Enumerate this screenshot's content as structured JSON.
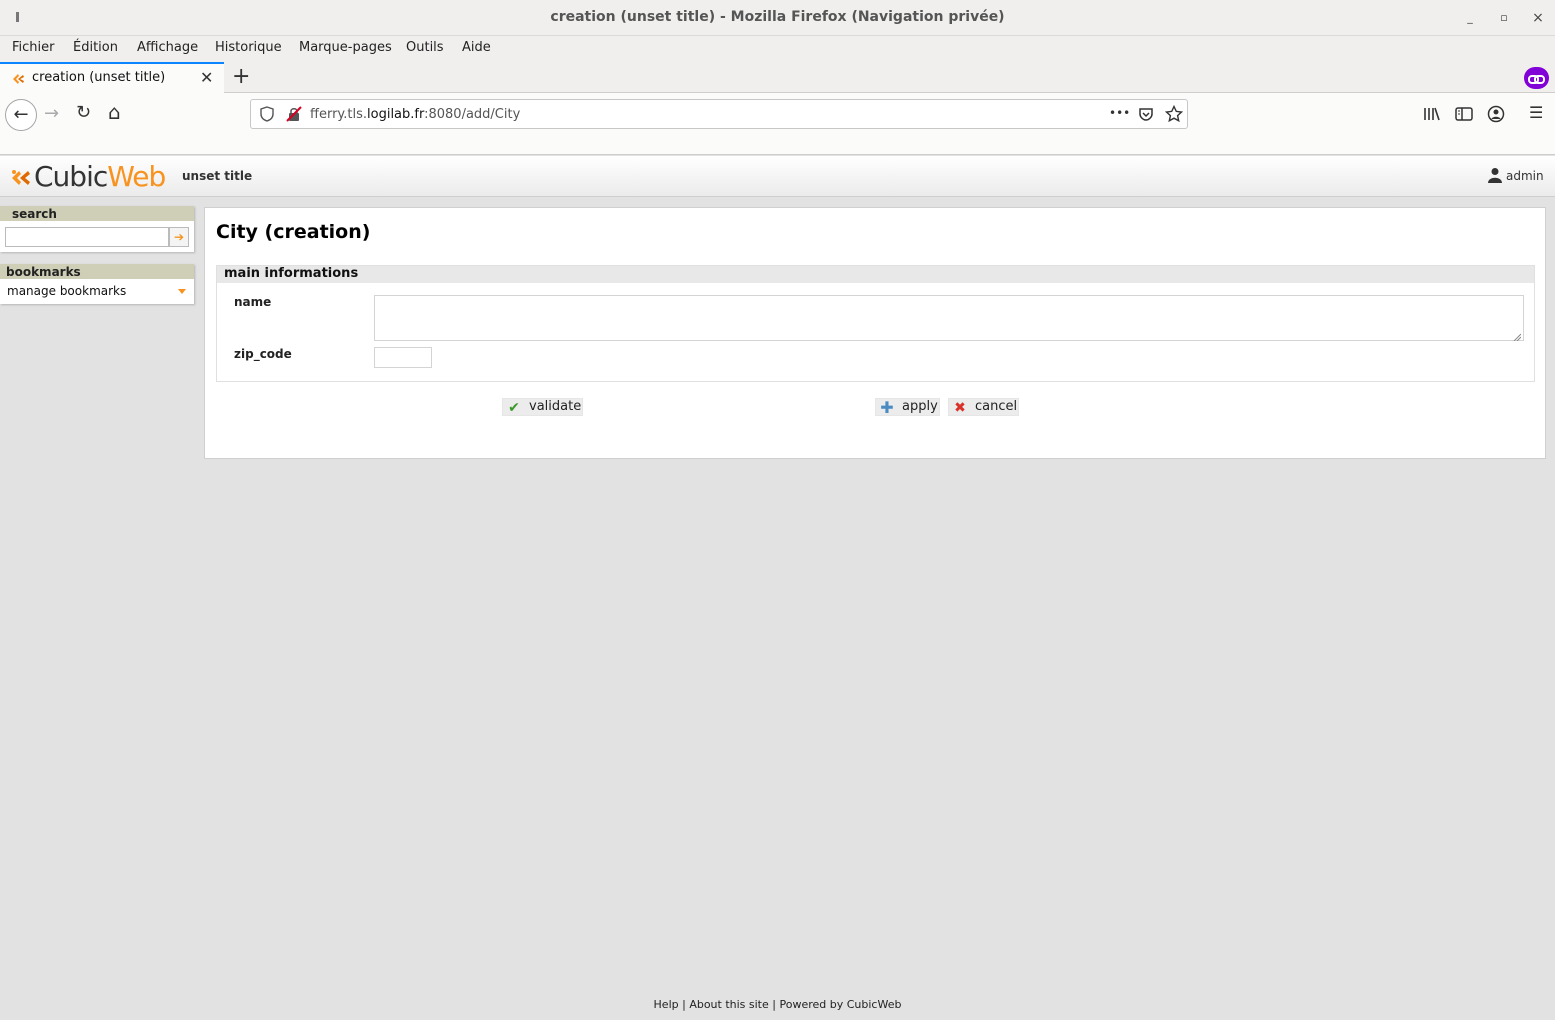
{
  "window": {
    "title": "creation (unset title) - Mozilla Firefox (Navigation privée)",
    "minimize_glyph": "_",
    "maximize_glyph": "▫",
    "close_glyph": "×"
  },
  "menubar": {
    "items": [
      "Fichier",
      "Édition",
      "Affichage",
      "Historique",
      "Marque-pages",
      "Outils",
      "Aide"
    ]
  },
  "tabs": {
    "active_label": "creation (unset title)",
    "close_glyph": "✕",
    "new_tab_glyph": "+"
  },
  "navbar": {
    "url_prefix": "fferry.tls.",
    "url_host": "logilab.fr",
    "url_suffix": ":8080/add/City",
    "page_actions_glyph": "•••",
    "back_glyph": "←",
    "forward_glyph": "→",
    "reload_glyph": "↻",
    "home_glyph": "⌂",
    "menu_glyph": "☰"
  },
  "header": {
    "logo_cubic": "Cubic",
    "logo_web": "Web",
    "title": "unset title",
    "user": "admin"
  },
  "sidebar": {
    "search_title": "search",
    "search_value": "",
    "search_go_glyph": "➔",
    "bookmarks_title": "bookmarks",
    "bookmarks_manage": "manage bookmarks"
  },
  "form": {
    "page_title": "City (creation)",
    "section_title": "main informations",
    "fields": [
      {
        "label": "name",
        "value": ""
      },
      {
        "label": "zip_code",
        "value": ""
      }
    ],
    "validate_label": "validate",
    "apply_label": "apply",
    "cancel_label": "cancel"
  },
  "footer": {
    "help": "Help",
    "about": "About this site",
    "powered": "Powered by CubicWeb",
    "separator": " | "
  },
  "colors": {
    "brand_orange": "#f7931e",
    "private_purple": "#8000d7",
    "tab_accent": "#0a84ff",
    "box_title_bg": "#cfceb7"
  },
  "icons": {
    "validate": "check-icon",
    "apply": "plus-icon",
    "cancel": "cross-icon"
  }
}
